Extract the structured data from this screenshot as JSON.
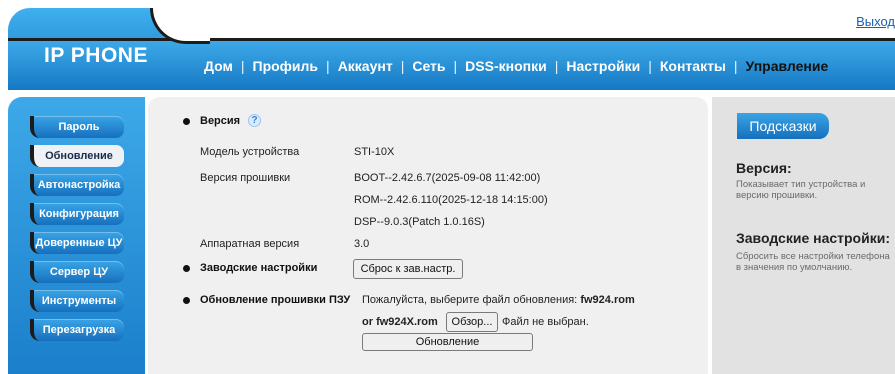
{
  "header": {
    "logout": "Выход",
    "logo": "IP PHONE",
    "nav": [
      {
        "label": "Дом"
      },
      {
        "label": "Профиль"
      },
      {
        "label": "Аккаунт"
      },
      {
        "label": "Сеть"
      },
      {
        "label": "DSS-кнопки"
      },
      {
        "label": "Настройки"
      },
      {
        "label": "Контакты"
      },
      {
        "label": "Управление"
      }
    ],
    "active_nav": "Управление"
  },
  "sidebar": {
    "items": [
      {
        "label": "Пароль"
      },
      {
        "label": "Обновление"
      },
      {
        "label": "Автонастройка"
      },
      {
        "label": "Конфигурация"
      },
      {
        "label": "Доверенные ЦУ"
      },
      {
        "label": "Сервер ЦУ"
      },
      {
        "label": "Инструменты"
      },
      {
        "label": "Перезагрузка"
      }
    ],
    "active_item": "Обновление"
  },
  "main": {
    "version_section": "Версия",
    "help_icon": "?",
    "model_label": "Модель устройства",
    "model_value": "STI-10X",
    "firmware_label": "Версия прошивки",
    "firmware_lines": [
      "BOOT--2.42.6.7(2025-09-08 11:42:00)",
      "ROM--2.42.6.110(2025-12-18 14:15:00)",
      "DSP--9.0.3(Patch 1.0.16S)"
    ],
    "hardware_label": "Аппаратная версия",
    "hardware_value": "3.0",
    "factory_section": "Заводские настройки",
    "factory_button": "Сброс к зав.настр.",
    "upgrade_section": "Обновление прошивки ПЗУ",
    "upgrade_prompt": "Пожалуйста, выберите файл обновления:",
    "upgrade_file1": "fw924.rom",
    "upgrade_or": "or",
    "upgrade_file2": "fw924X.rom",
    "browse_button": "Обзор...",
    "no_file": "Файл не выбран.",
    "update_button": "Обновление"
  },
  "hints": {
    "tab": "Подсказки",
    "items": [
      {
        "title": "Версия:",
        "desc": "Показывает тип устройства и версию прошивки."
      },
      {
        "title": "Заводские настройки:",
        "desc": "Сбросить все настройки телефона в значения по умолчанию."
      }
    ]
  },
  "colors": {
    "accent": "#1679c4",
    "accent_light": "#3da9e8",
    "link": "#1a5fb4"
  }
}
